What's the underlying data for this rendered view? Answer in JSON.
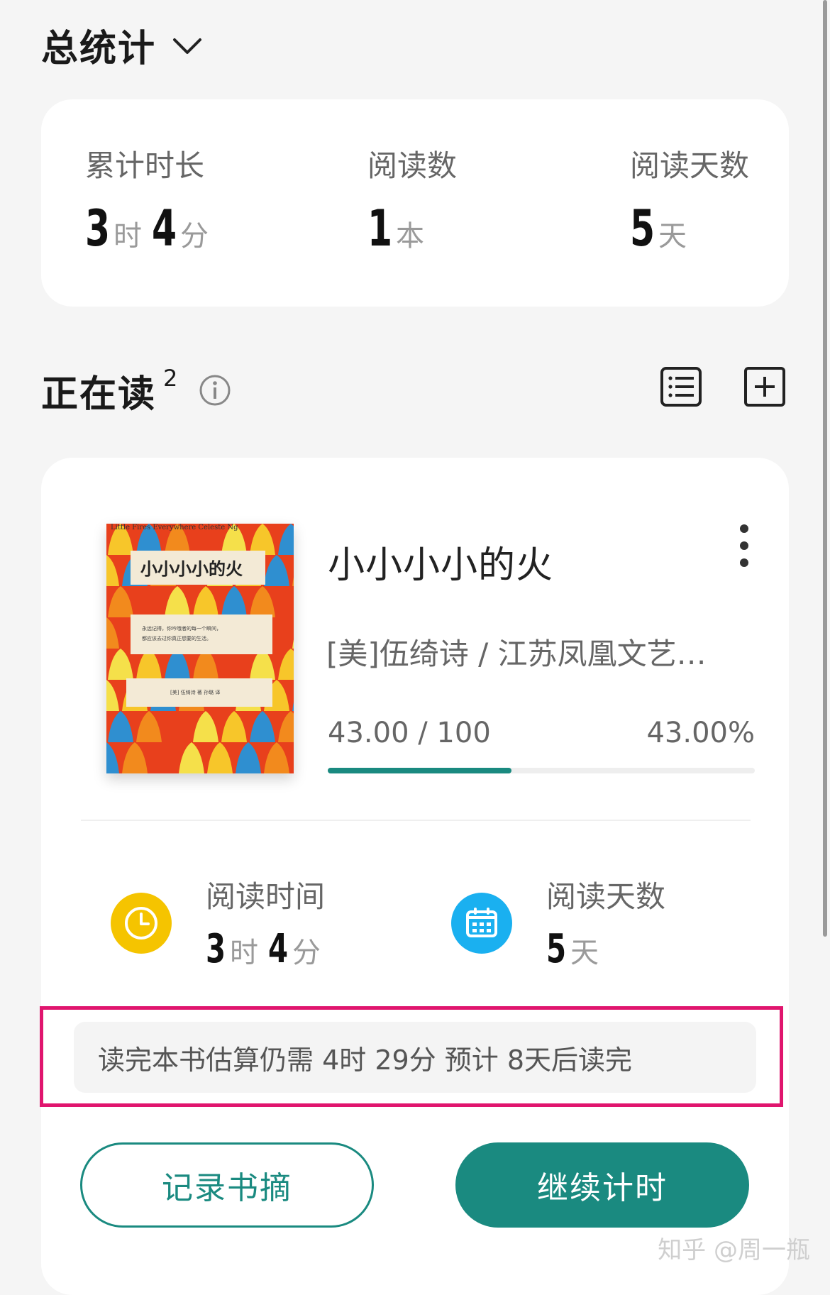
{
  "header": {
    "title": "总统计"
  },
  "summary": {
    "total_time_label": "累计时长",
    "hours": "3",
    "hours_unit": "时",
    "minutes": "4",
    "minutes_unit": "分",
    "books_label": "阅读数",
    "books": "1",
    "books_unit": "本",
    "days_label": "阅读天数",
    "days": "5",
    "days_unit": "天"
  },
  "reading": {
    "title": "正在读",
    "count": "2"
  },
  "book": {
    "title": "小小小小的火",
    "author": "[美]伍绮诗 / 江苏凤凰文艺…",
    "cover_title": "小小小小的火",
    "cover_top_text": "Little Fires Everywhere  Celeste Ng",
    "cover_tagline_1": "永远记得，你吟哦者的每一个瞬间，",
    "cover_tagline_2": "都应该去过你真正想要的生活。",
    "cover_credit": "[美] 伍绮诗 著  孙璐 译",
    "progress_text": "43.00 / 100",
    "progress_pct": "43.00%",
    "progress_value": 0.43,
    "read_time_label": "阅读时间",
    "read_hours": "3",
    "read_hours_unit": "时",
    "read_minutes": "4",
    "read_minutes_unit": "分",
    "read_days_label": "阅读天数",
    "read_days": "5",
    "read_days_unit": "天",
    "estimate": "读完本书估算仍需 4时 29分 预计 8天后读完"
  },
  "buttons": {
    "note": "记录书摘",
    "continue": "继续计时"
  },
  "watermark": "知乎 @周一瓶",
  "colors": {
    "accent": "#1a8a80",
    "clock_icon": "#f5c400",
    "calendar_icon": "#1ab0f0",
    "highlight_border": "#e0156e"
  }
}
